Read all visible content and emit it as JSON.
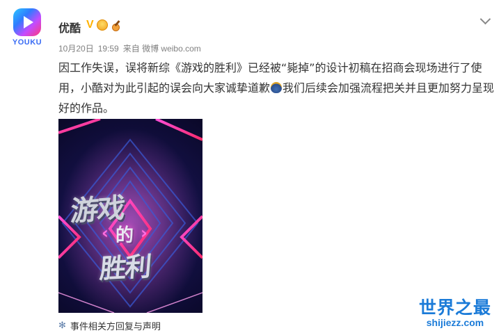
{
  "post": {
    "logo_text": "YOUKU",
    "username": "优酷",
    "verified_mark": "V",
    "date": "10月20日",
    "time": "19:59",
    "source": "来自 微博 weibo.com",
    "text_part1": "因工作失误，误将新综《游戏的胜利》已经被“毙掉”的设计初稿在招商会现场进行了使用，小酷对为此引起的误会向大家诚挚道歉",
    "text_part2": "我们后续会加强流程把关并且更加努力呈现好的作品。",
    "footer_link": "事件相关方回复与声明"
  },
  "poster": {
    "title_line1": "游戏",
    "title_line2": "的",
    "title_line3": "胜利",
    "bracket_left": "‹",
    "bracket_right": "›"
  },
  "watermark": {
    "cn": "世界之最",
    "en": "shijiezz.com"
  },
  "icons": {
    "avatar": "youku-logo-icon",
    "verified": "verified-v-icon",
    "medal": "medal-icon",
    "guitar": "guitar-icon",
    "menu": "chevron-down-icon",
    "emoji": "money-bag-emoji-icon",
    "link": "sparkle-icon"
  },
  "colors": {
    "accent_gold": "#ffb200",
    "meta_gray": "#808080",
    "link_blue": "#5a7ba8",
    "watermark_blue": "#1b7bd8"
  }
}
